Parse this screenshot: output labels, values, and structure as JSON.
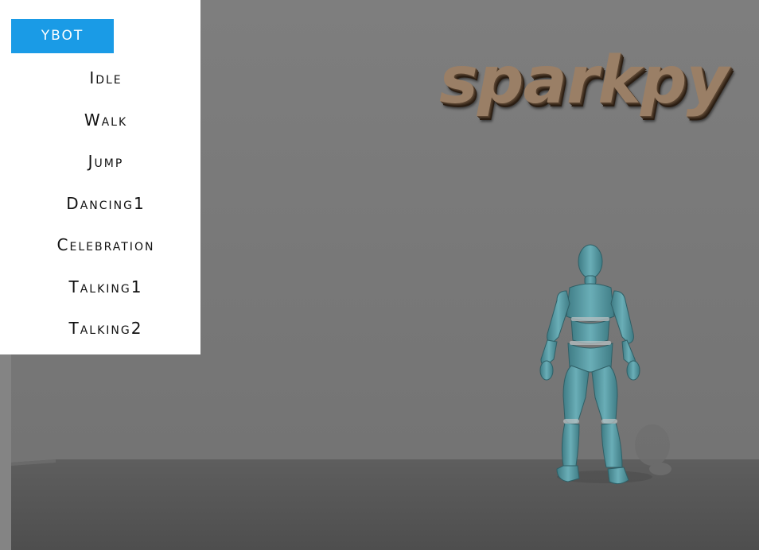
{
  "menu": {
    "model_label": "YBOT",
    "items": [
      {
        "label": "Idle"
      },
      {
        "label": "Walk"
      },
      {
        "label": "Jump"
      },
      {
        "label": "Dancing1"
      },
      {
        "label": "Celebration"
      },
      {
        "label": "Talking1"
      },
      {
        "label": "Talking2"
      }
    ]
  },
  "scene": {
    "logo_text": "sparkpy",
    "colors": {
      "menu_accent": "#1a9be6",
      "wall": "#7a7a7a",
      "floor": "#585858",
      "character": "#5c9fa8",
      "logo": "#9a7f66"
    }
  }
}
